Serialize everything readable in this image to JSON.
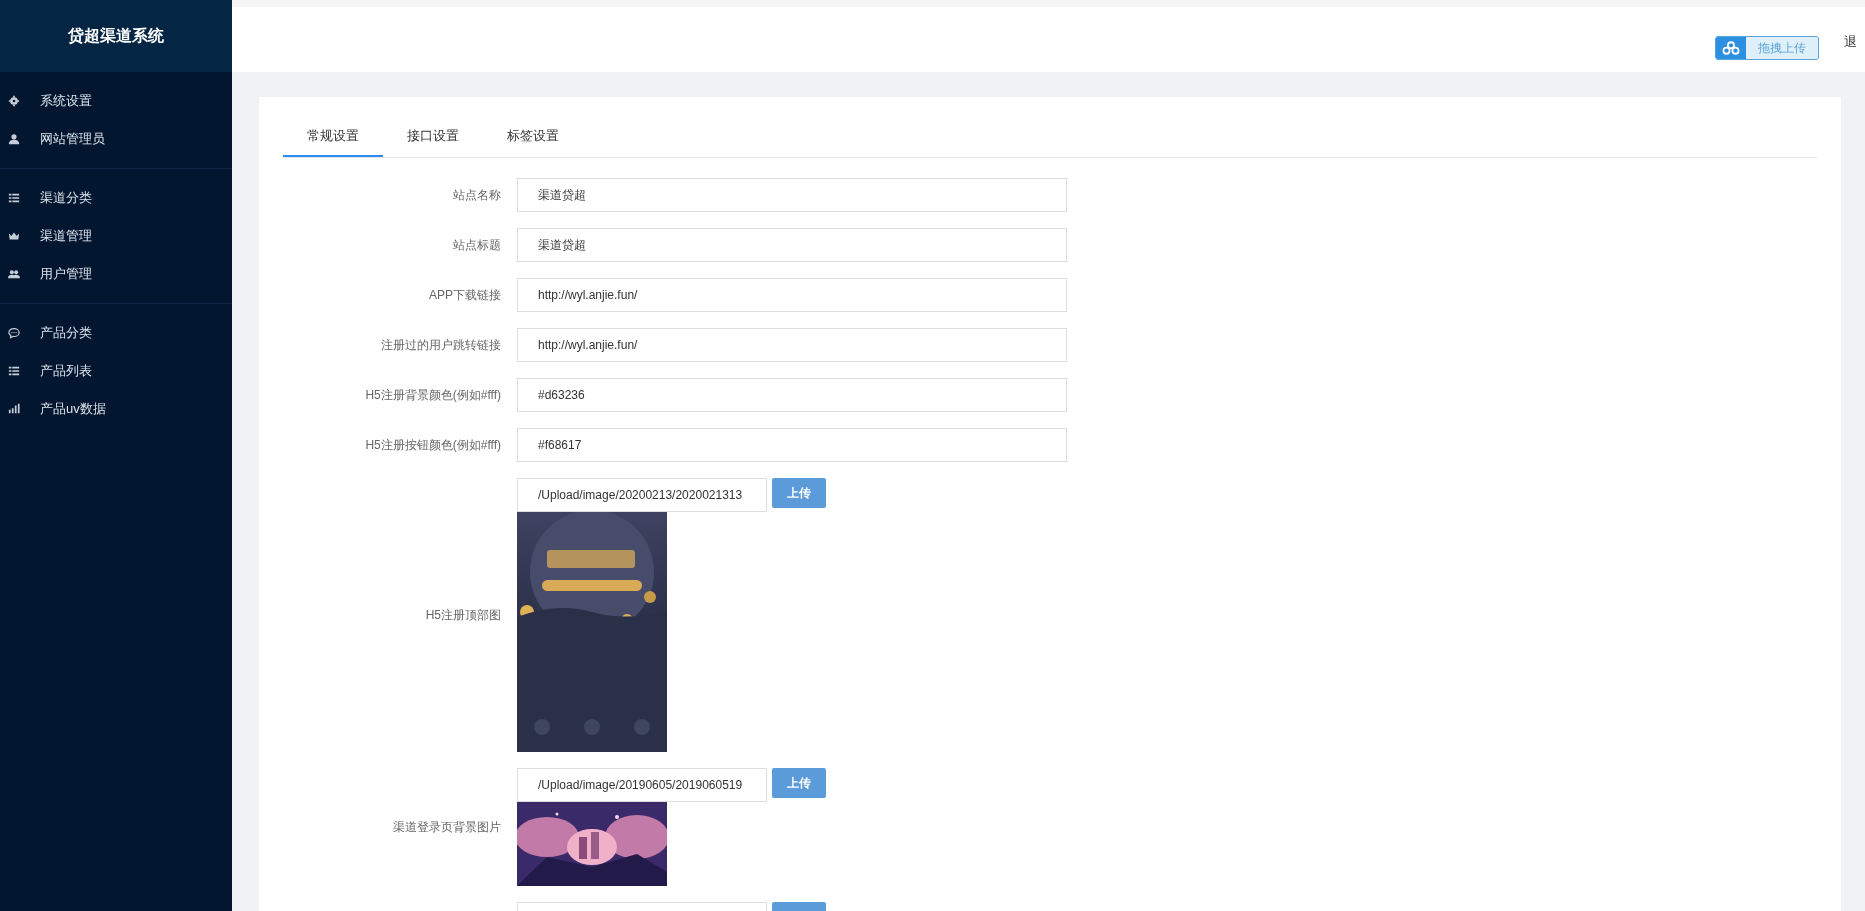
{
  "sidebar": {
    "title": "贷超渠道系统",
    "groups": [
      [
        {
          "label": "系统设置"
        },
        {
          "label": "网站管理员"
        }
      ],
      [
        {
          "label": "渠道分类"
        },
        {
          "label": "渠道管理"
        },
        {
          "label": "用户管理"
        }
      ],
      [
        {
          "label": "产品分类"
        },
        {
          "label": "产品列表"
        },
        {
          "label": "产品uv数据"
        }
      ]
    ]
  },
  "topbar": {
    "upload_widget": "拖拽上传",
    "logout": "退"
  },
  "tabs": [
    {
      "label": "常规设置",
      "selected": true
    },
    {
      "label": "接口设置",
      "selected": false
    },
    {
      "label": "标签设置",
      "selected": false
    }
  ],
  "fields": [
    {
      "kind": "text",
      "label": "站点名称",
      "value": "渠道贷超"
    },
    {
      "kind": "text",
      "label": "站点标题",
      "value": "渠道贷超"
    },
    {
      "kind": "text",
      "label": "APP下载链接",
      "value": "http://wyl.anjie.fun/"
    },
    {
      "kind": "text",
      "label": "注册过的用户跳转链接",
      "value": "http://wyl.anjie.fun/"
    },
    {
      "kind": "text",
      "label": "H5注册背景颜色(例如#fff)",
      "value": "#d63236"
    },
    {
      "kind": "text",
      "label": "H5注册按钮颜色(例如#fff)",
      "value": "#f68617"
    },
    {
      "label": "H5注册顶部图",
      "value": "/Upload/image/20200213/2020021313",
      "button": "上传"
    },
    {
      "label": "渠道登录页背景图片",
      "value": "/Upload/image/20190605/2019060519",
      "button": "上传"
    },
    {
      "kind": "stub"
    }
  ]
}
